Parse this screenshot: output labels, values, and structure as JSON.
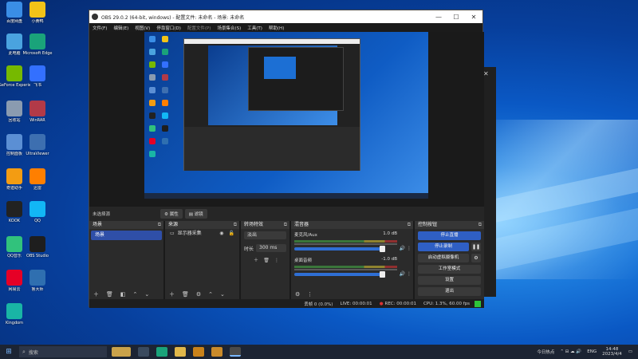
{
  "obs": {
    "title": "OBS 29.0.2 (64-bit, windows) - 配置文件: 未命名 - 场景: 未命名",
    "menu": [
      "文件(F)",
      "编辑(E)",
      "视图(V)",
      "停靠窗口(D)",
      "配置文件(P)",
      "场景集合(S)",
      "工具(T)",
      "帮助(H)"
    ],
    "context": {
      "no_source": "未选择源",
      "properties": "属性",
      "filters": "滤镜"
    },
    "scenes": {
      "title": "场景",
      "items": [
        "场景"
      ]
    },
    "sources": {
      "title": "来源",
      "items": [
        {
          "name": "显示器采集"
        }
      ]
    },
    "transitions": {
      "title": "转场特效",
      "type": "淡出",
      "duration_label": "时长",
      "duration": "300 ms"
    },
    "mixer": {
      "title": "混音器",
      "channels": [
        {
          "name": "麦克风/Aux",
          "db": "1.0 dB"
        },
        {
          "name": "桌面音频",
          "db": "-1.0 dB"
        }
      ]
    },
    "controls": {
      "title": "控制按钮",
      "stream": "停止直播",
      "record": "停止录制",
      "vcam": "启动虚拟摄像机",
      "studio": "工作室模式",
      "settings": "设置",
      "exit": "退出"
    },
    "status": {
      "dropped": "丢帧 0 (0.0%)",
      "live": "LIVE: 00:00:01",
      "rec": "REC: 00:00:01",
      "cpu": "CPU: 1.3%, 60.00 fps"
    }
  },
  "desktop_icons": [
    {
      "label": "百度网盘",
      "color": "#3a8ee6"
    },
    {
      "label": "小黄鸭",
      "color": "#f2c318"
    },
    {
      "label": "此电脑",
      "color": "#4aa3df"
    },
    {
      "label": "Microsoft Edge",
      "color": "#1aa37a"
    },
    {
      "label": "GeForce Experience",
      "color": "#76b900"
    },
    {
      "label": "飞书",
      "color": "#3370ff"
    },
    {
      "label": "回收站",
      "color": "#8a9bb0"
    },
    {
      "label": "WinRAR",
      "color": "#b23a48"
    },
    {
      "label": "控制面板",
      "color": "#5b8fd4"
    },
    {
      "label": "UltraViewer",
      "color": "#3d6fb0"
    },
    {
      "label": "奇迹助手",
      "color": "#f39c12"
    },
    {
      "label": "迅雷",
      "color": "#ff7f00"
    },
    {
      "label": "KOOK",
      "color": "#222222"
    },
    {
      "label": "QQ",
      "color": "#12b7f5"
    },
    {
      "label": "QQ音乐",
      "color": "#31c27c"
    },
    {
      "label": "OBS Studio",
      "color": "#1e1e1e"
    },
    {
      "label": "网易云",
      "color": "#e60026"
    },
    {
      "label": "鲁大师",
      "color": "#2f6fb0"
    },
    {
      "label": "Kingdom",
      "color": "#19b5a5"
    }
  ],
  "taskbar": {
    "search": "搜索",
    "news": "今日热点",
    "lang": "ENG",
    "time": "14:48",
    "date": "2023/4/4"
  }
}
